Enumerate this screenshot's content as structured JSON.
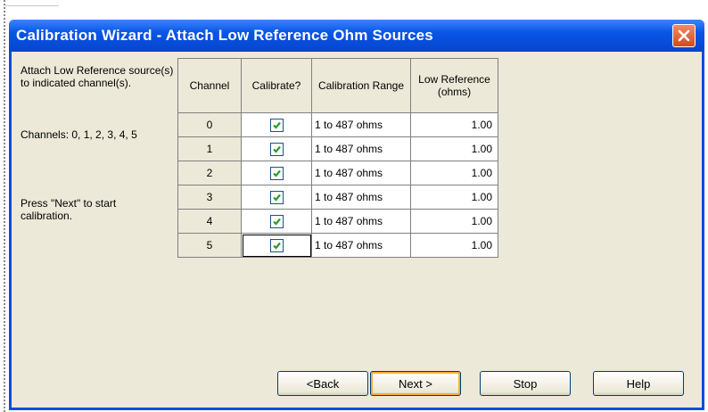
{
  "window": {
    "title": "Calibration Wizard - Attach Low Reference Ohm Sources"
  },
  "instructions": {
    "line1": "Attach Low Reference source(s) to indicated channel(s).",
    "channels": "Channels:  0, 1, 2, 3, 4, 5",
    "press": "Press \"Next\" to start calibration."
  },
  "table": {
    "headers": [
      "Channel",
      "Calibrate?",
      "Calibration Range",
      "Low Reference (ohms)"
    ],
    "rows": [
      {
        "channel": "0",
        "calibrate": true,
        "range": "1 to 487 ohms",
        "low": "1.00"
      },
      {
        "channel": "1",
        "calibrate": true,
        "range": "1 to 487 ohms",
        "low": "1.00"
      },
      {
        "channel": "2",
        "calibrate": true,
        "range": "1 to 487 ohms",
        "low": "1.00"
      },
      {
        "channel": "3",
        "calibrate": true,
        "range": "1 to 487 ohms",
        "low": "1.00"
      },
      {
        "channel": "4",
        "calibrate": true,
        "range": "1 to 487 ohms",
        "low": "1.00"
      },
      {
        "channel": "5",
        "calibrate": true,
        "range": "1 to 487 ohms",
        "low": "1.00"
      }
    ]
  },
  "buttons": {
    "back": "<Back",
    "next": "Next >",
    "stop": "Stop",
    "help": "Help"
  },
  "colors": {
    "titlebar": "#0a55e5",
    "dialog_bg": "#ece9d8",
    "checkmark": "#21a121",
    "close_button": "#d24a1e"
  },
  "icons": {
    "close": "close-icon",
    "checkbox": "checkmark-icon"
  }
}
